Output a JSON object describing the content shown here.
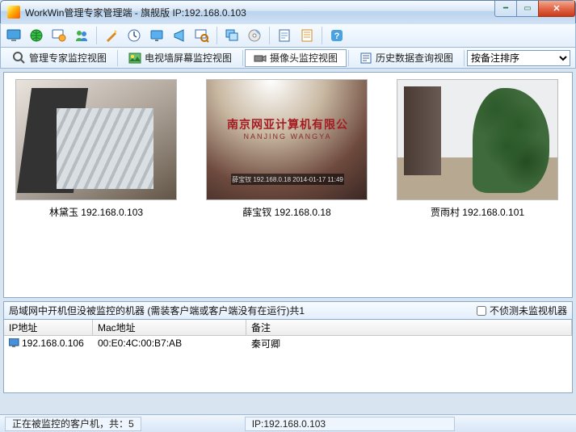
{
  "window": {
    "title": "WorkWin管理专家管理端 - 旗舰版 IP:192.168.0.103"
  },
  "views": {
    "t1": "管理专家监控视图",
    "t2": "电视墙屏幕监控视图",
    "t3": "摄像头监控视图",
    "t4": "历史数据查询视图"
  },
  "sort": {
    "selected": "按备注排序"
  },
  "cams": [
    {
      "name": "林黛玉",
      "ip": "192.168.0.103"
    },
    {
      "name": "薛宝钗",
      "ip": "192.168.0.18"
    },
    {
      "name": "贾雨村",
      "ip": "192.168.0.101"
    }
  ],
  "cam2_overlay": {
    "cn": "南京网亚计算机有限公",
    "en": "NANJING WANGYA",
    "bar": "薛宝钗 192.168.0.18 2014-01-17 11:49"
  },
  "unmon": {
    "title": "局域网中开机但没被监控的机器 (需装客户端或客户端没有在运行)共1",
    "chk_label": "不侦测未监视机器",
    "cols": {
      "c1": "IP地址",
      "c2": "Mac地址",
      "c3": "备注"
    },
    "rows": [
      {
        "ip": "192.168.0.106",
        "mac": "00:E0:4C:00:B7:AB",
        "note": "秦可卿"
      }
    ]
  },
  "status": {
    "left": "正在被监控的客户机，共：5",
    "ip": "IP:192.168.0.103"
  }
}
